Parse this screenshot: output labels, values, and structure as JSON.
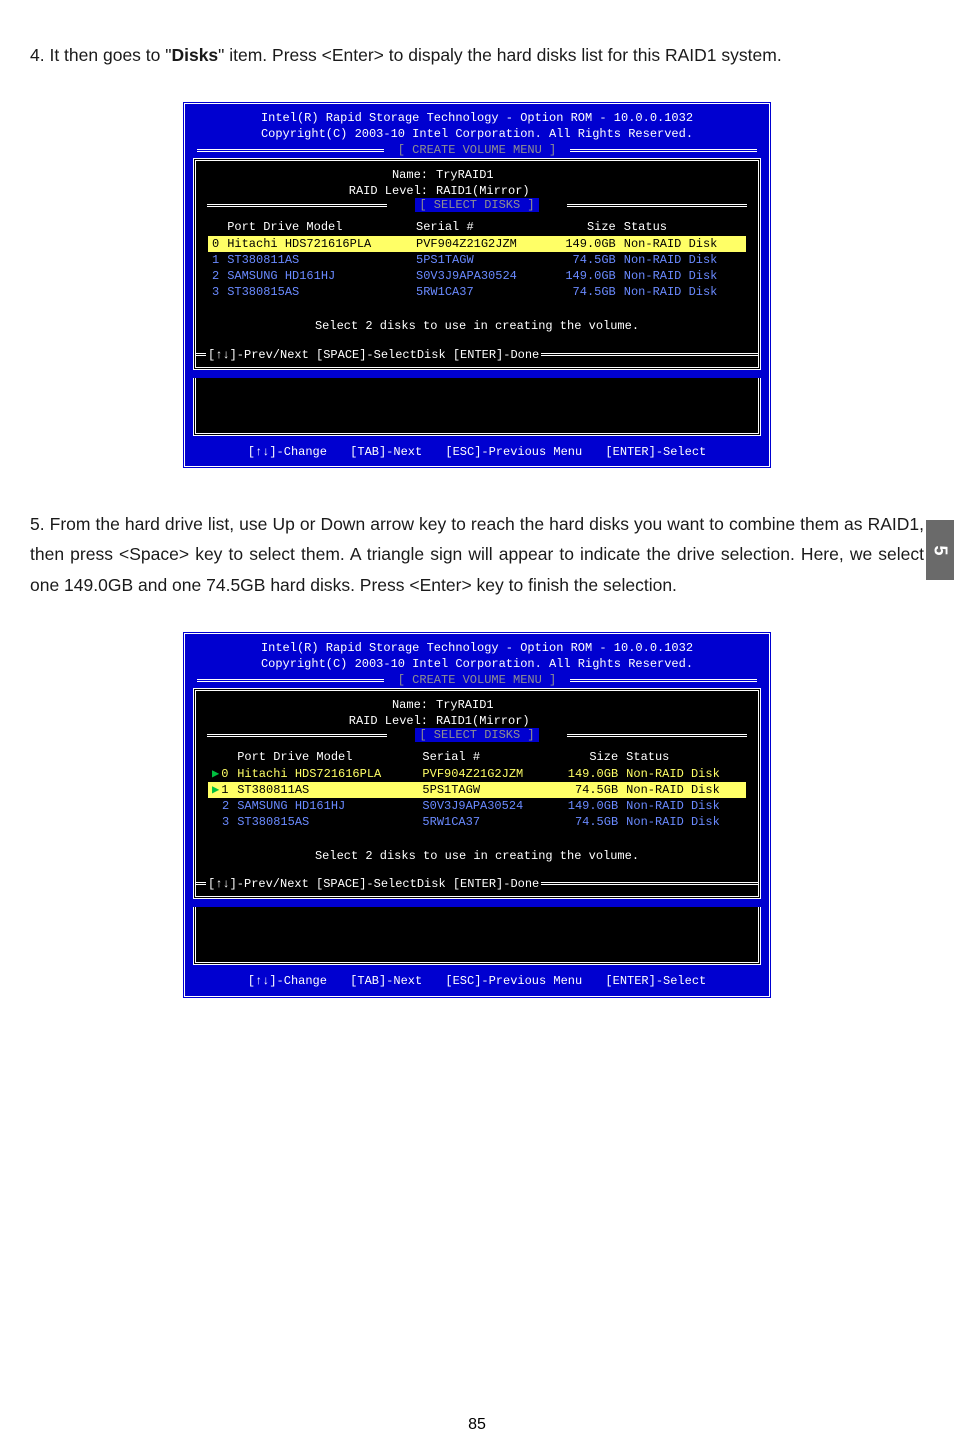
{
  "step4": {
    "number": "4.",
    "text_before_bold": " It then goes to \"",
    "bold": "Disks",
    "text_after_bold": "\" item. Press <Enter> to dispaly the hard disks list for this RAID1 system."
  },
  "step5": {
    "number": "5.",
    "text": " From the hard drive list, use Up or Down arrow key to reach the hard disks you want to combine them as RAID1, then press <Space> key to select them. A triangle sign will appear to indicate the drive selection. Here, we select one 149.0GB and one 74.5GB hard disks. Press <Enter> key to finish the selection."
  },
  "bios": {
    "title1": "Intel(R) Rapid Storage Technology - Option ROM - 10.0.0.1032",
    "title2": "Copyright(C) 2003-10 Intel Corporation.   All Rights Reserved.",
    "create_menu": "[ CREATE VOLUME MENU ]",
    "select_disks": "[ SELECT DISKS ]",
    "name_label": "Name:",
    "name_value": "TryRAID1",
    "raid_label": "RAID Level:",
    "raid_value": "RAID1(Mirror)",
    "headers": {
      "port": "Port Drive Model",
      "serial": "Serial #",
      "size": "Size",
      "status": "Status"
    },
    "rows": [
      {
        "port": "0",
        "model": "Hitachi HDS721616PLA",
        "serial": "PVF904Z21G2JZM",
        "size": "149.0GB",
        "status": "Non-RAID Disk"
      },
      {
        "port": "1",
        "model": "ST380811AS",
        "serial": "5PS1TAGW",
        "size": "74.5GB",
        "status": "Non-RAID Disk"
      },
      {
        "port": "2",
        "model": "SAMSUNG HD161HJ",
        "serial": "S0V3J9APA30524",
        "size": "149.0GB",
        "status": "Non-RAID Disk"
      },
      {
        "port": "3",
        "model": "ST380815AS",
        "serial": "5RW1CA37",
        "size": "74.5GB",
        "status": "Non-RAID Disk"
      }
    ],
    "helper": "Select 2 disks to use in creating the volume.",
    "done": "[↑↓]-Prev/Next [SPACE]-SelectDisk [ENTER]-Done",
    "footer": {
      "change": "[↑↓]-Change",
      "tab": "[TAB]-Next",
      "esc": "[ESC]-Previous Menu",
      "enter": "[ENTER]-Select"
    }
  },
  "side_tab": "5",
  "page_number": "85"
}
